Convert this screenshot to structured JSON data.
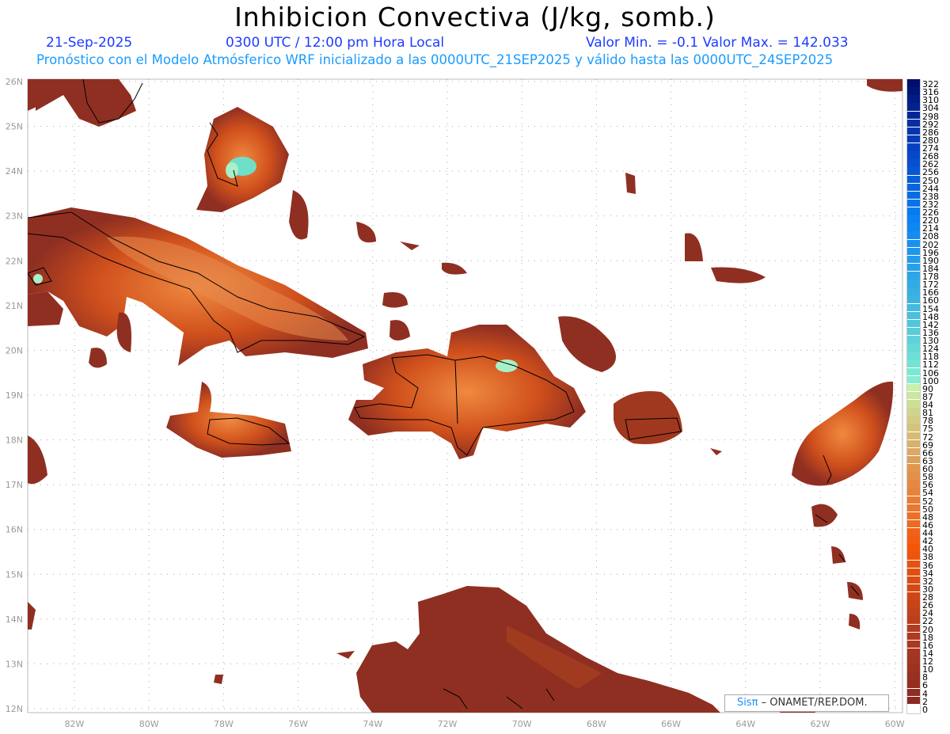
{
  "header": {
    "title": "Inhibicion Convectiva (J/kg, somb.)",
    "date": "21-Sep-2025",
    "time": "0300 UTC / 12:00 pm Hora Local",
    "minmax": "Valor Min. = -0.1  Valor Max. = 142.033",
    "forecast_line": "Pronóstico con el Modelo Atmósferico WRF inicializado a las 0000UTC_21SEP2025 y válido hasta las  0000UTC_24SEP2025"
  },
  "map": {
    "lat_labels": [
      "26N",
      "25N",
      "24N",
      "23N",
      "22N",
      "21N",
      "20N",
      "19N",
      "18N",
      "17N",
      "16N",
      "15N",
      "14N",
      "13N",
      "12N"
    ],
    "lon_labels": [
      "82W",
      "80W",
      "78W",
      "76W",
      "74W",
      "72W",
      "70W",
      "68W",
      "66W",
      "64W",
      "62W",
      "60W"
    ]
  },
  "credit": {
    "sis": "Sisπ",
    "org": " –  ONAMET/REP.DOM."
  },
  "chart_data": {
    "type": "heatmap",
    "title": "Inhibicion Convectiva (J/kg, somb.)",
    "colorbar_levels": [
      322,
      316,
      310,
      304,
      298,
      292,
      286,
      280,
      274,
      268,
      262,
      256,
      250,
      244,
      238,
      232,
      226,
      220,
      214,
      208,
      202,
      196,
      190,
      184,
      178,
      172,
      166,
      160,
      154,
      148,
      142,
      136,
      130,
      124,
      118,
      112,
      106,
      100,
      90,
      87,
      84,
      81,
      78,
      75,
      72,
      69,
      66,
      63,
      60,
      58,
      56,
      54,
      52,
      50,
      48,
      46,
      44,
      42,
      40,
      38,
      36,
      34,
      32,
      30,
      28,
      26,
      24,
      22,
      20,
      18,
      16,
      14,
      12,
      10,
      8,
      6,
      4,
      2,
      0
    ],
    "lon_range": [
      -83.25,
      -59.8
    ],
    "lat_range": [
      11.9,
      26.1
    ],
    "value_min": -0.1,
    "value_max": 142.033
  }
}
